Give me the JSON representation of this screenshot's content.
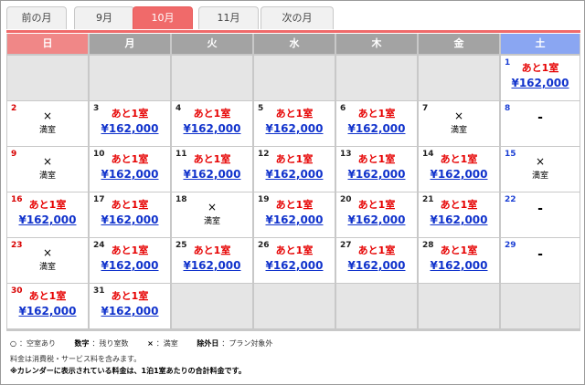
{
  "tabs": [
    {
      "label": "前の月",
      "active": false
    },
    {
      "label": "9月",
      "active": false
    },
    {
      "label": "10月",
      "active": true
    },
    {
      "label": "11月",
      "active": false
    },
    {
      "label": "次の月",
      "active": false
    }
  ],
  "weekdays": [
    "日",
    "月",
    "火",
    "水",
    "木",
    "金",
    "土"
  ],
  "status_text": {
    "available": "あと1室",
    "full_mark": "×",
    "full_label": "満室",
    "excluded": "-"
  },
  "weeks": [
    [
      null,
      null,
      null,
      null,
      null,
      null,
      {
        "day": "1",
        "type": "avail",
        "price": "¥162,000"
      }
    ],
    [
      {
        "day": "2",
        "type": "full"
      },
      {
        "day": "3",
        "type": "avail",
        "price": "¥162,000"
      },
      {
        "day": "4",
        "type": "avail",
        "price": "¥162,000"
      },
      {
        "day": "5",
        "type": "avail",
        "price": "¥162,000"
      },
      {
        "day": "6",
        "type": "avail",
        "price": "¥162,000"
      },
      {
        "day": "7",
        "type": "full"
      },
      {
        "day": "8",
        "type": "excluded"
      }
    ],
    [
      {
        "day": "9",
        "type": "full"
      },
      {
        "day": "10",
        "type": "avail",
        "price": "¥162,000"
      },
      {
        "day": "11",
        "type": "avail",
        "price": "¥162,000"
      },
      {
        "day": "12",
        "type": "avail",
        "price": "¥162,000"
      },
      {
        "day": "13",
        "type": "avail",
        "price": "¥162,000"
      },
      {
        "day": "14",
        "type": "avail",
        "price": "¥162,000"
      },
      {
        "day": "15",
        "type": "full"
      }
    ],
    [
      {
        "day": "16",
        "type": "avail",
        "price": "¥162,000"
      },
      {
        "day": "17",
        "type": "avail",
        "price": "¥162,000"
      },
      {
        "day": "18",
        "type": "full"
      },
      {
        "day": "19",
        "type": "avail",
        "price": "¥162,000"
      },
      {
        "day": "20",
        "type": "avail",
        "price": "¥162,000"
      },
      {
        "day": "21",
        "type": "avail",
        "price": "¥162,000"
      },
      {
        "day": "22",
        "type": "excluded"
      }
    ],
    [
      {
        "day": "23",
        "type": "full"
      },
      {
        "day": "24",
        "type": "avail",
        "price": "¥162,000"
      },
      {
        "day": "25",
        "type": "avail",
        "price": "¥162,000"
      },
      {
        "day": "26",
        "type": "avail",
        "price": "¥162,000"
      },
      {
        "day": "27",
        "type": "avail",
        "price": "¥162,000"
      },
      {
        "day": "28",
        "type": "avail",
        "price": "¥162,000"
      },
      {
        "day": "29",
        "type": "excluded"
      }
    ],
    [
      {
        "day": "30",
        "type": "avail",
        "price": "¥162,000"
      },
      {
        "day": "31",
        "type": "avail",
        "price": "¥162,000"
      },
      null,
      null,
      null,
      null,
      null
    ]
  ],
  "legend": [
    {
      "key": "○",
      "text": "：空室あり"
    },
    {
      "key": "数字",
      "text": "：残り室数"
    },
    {
      "key": "×",
      "text": "：満室"
    },
    {
      "key": "除外日",
      "text": "：プラン対象外"
    }
  ],
  "notes": {
    "tax": "料金は消費税・サービス料を含みます。",
    "price_note": "※カレンダーに表示されている料金は、1泊1室あたりの合計料金です。"
  },
  "colors": {
    "accent": "#f06a6a",
    "sunday": "#f08787",
    "saturday": "#8aa6f2",
    "weekday_header": "#a3a3a3",
    "available_text": "#e60000",
    "price_link": "#1133cc"
  }
}
